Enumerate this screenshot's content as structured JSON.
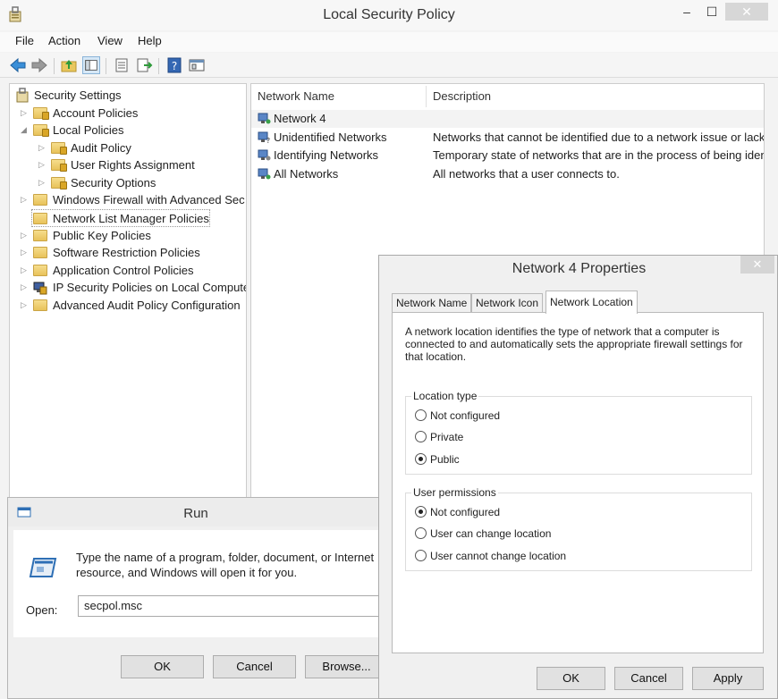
{
  "main_window": {
    "title": "Local Security Policy",
    "window_controls": {
      "minimize": "–",
      "maximize": "☐",
      "close": "✕"
    },
    "menu": [
      "File",
      "Action",
      "View",
      "Help"
    ],
    "toolbar_icons": [
      "back-icon",
      "forward-icon",
      "up-folder-icon",
      "show-hide-tree-icon",
      "properties-icon",
      "export-list-icon",
      "help-icon",
      "console-icon"
    ]
  },
  "tree": [
    {
      "label": "Security Settings",
      "level": 0,
      "arrow": "",
      "icon": "security-settings-icon"
    },
    {
      "label": "Account Policies",
      "level": 1,
      "arrow": "▷",
      "icon": "folder-lock-icon"
    },
    {
      "label": "Local Policies",
      "level": 1,
      "arrow": "◢",
      "icon": "folder-lock-icon"
    },
    {
      "label": "Audit Policy",
      "level": 2,
      "arrow": "▷",
      "icon": "folder-lock-icon"
    },
    {
      "label": "User Rights Assignment",
      "level": 2,
      "arrow": "▷",
      "icon": "folder-lock-icon"
    },
    {
      "label": "Security Options",
      "level": 2,
      "arrow": "▷",
      "icon": "folder-lock-icon"
    },
    {
      "label": "Windows Firewall with Advanced Sec",
      "level": 1,
      "arrow": "▷",
      "icon": "folder-icon"
    },
    {
      "label": "Network List Manager Policies",
      "level": 1,
      "arrow": "",
      "icon": "folder-icon"
    },
    {
      "label": "Public Key Policies",
      "level": 1,
      "arrow": "▷",
      "icon": "folder-icon"
    },
    {
      "label": "Software Restriction Policies",
      "level": 1,
      "arrow": "▷",
      "icon": "folder-icon"
    },
    {
      "label": "Application Control Policies",
      "level": 1,
      "arrow": "▷",
      "icon": "folder-icon"
    },
    {
      "label": "IP Security Policies on Local Compute",
      "level": 1,
      "arrow": "▷",
      "icon": "ip-security-icon"
    },
    {
      "label": "Advanced Audit Policy Configuration",
      "level": 1,
      "arrow": "▷",
      "icon": "folder-icon"
    }
  ],
  "list": {
    "columns": {
      "name": "Network Name",
      "description": "Description"
    },
    "rows": [
      {
        "name": "Network  4",
        "description": ""
      },
      {
        "name": "Unidentified Networks",
        "description": "Networks that cannot be identified due to a network issue or lack"
      },
      {
        "name": "Identifying Networks",
        "description": "Temporary state of networks that are in the process of being iden"
      },
      {
        "name": "All Networks",
        "description": "All networks that a user connects to."
      }
    ]
  },
  "run_dialog": {
    "title": "Run",
    "description": "Type the name of a program, folder, document, or Internet resource, and Windows will open it for you.",
    "open_label": "Open:",
    "open_value": "secpol.msc",
    "ok": "OK",
    "cancel": "Cancel",
    "browse": "Browse..."
  },
  "properties_dialog": {
    "title": "Network  4 Properties",
    "close": "✕",
    "tabs": [
      "Network Name",
      "Network Icon",
      "Network Location"
    ],
    "active_tab": "Network Location",
    "description": "A network location identifies the type of network that a computer is connected to and automatically sets the appropriate firewall settings for that location.",
    "location_type": {
      "label": "Location type",
      "options": [
        "Not configured",
        "Private",
        "Public"
      ],
      "selected": "Public"
    },
    "user_permissions": {
      "label": "User permissions",
      "options": [
        "Not configured",
        "User can change location",
        "User cannot change location"
      ],
      "selected": "Not configured"
    },
    "ok": "OK",
    "cancel": "Cancel",
    "apply": "Apply"
  }
}
